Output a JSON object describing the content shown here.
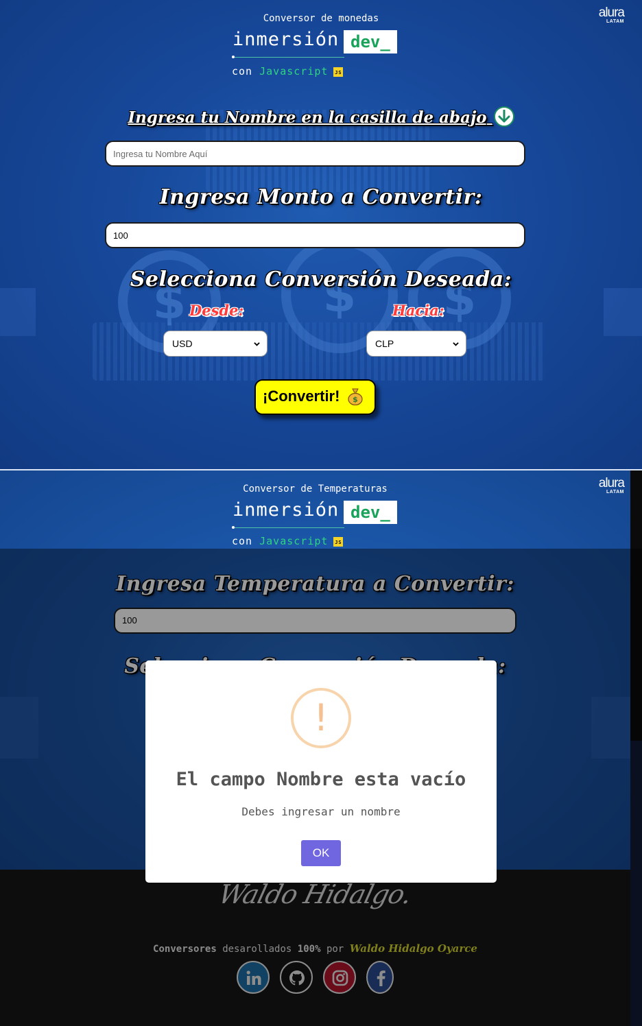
{
  "currency": {
    "header_title": "Conversor de monedas",
    "logo_word": "inmersión",
    "logo_dev": "dev_",
    "logo_con": "con",
    "logo_lang": "Javascript",
    "js_badge": "JS",
    "brand_main": "alura",
    "brand_sub": "LATAM",
    "name_heading": "Ingresa tu Nombre en la casilla de abajo",
    "name_placeholder": "Ingresa tu Nombre Aquí",
    "amount_heading": "Ingresa Monto a Convertir:",
    "amount_value": "100",
    "select_heading": "Selecciona Conversión Deseada:",
    "from_label": "Desde:",
    "to_label": "Hacia:",
    "from_value": "USD",
    "to_value": "CLP",
    "convert_button": "¡Convertir!"
  },
  "temperature": {
    "header_title": "Conversor de Temperaturas",
    "logo_word": "inmersión",
    "logo_dev": "dev_",
    "logo_con": "con",
    "logo_lang": "Javascript",
    "js_badge": "JS",
    "brand_main": "alura",
    "brand_sub": "LATAM",
    "amount_heading": "Ingresa Temperatura a Convertir:",
    "amount_value": "100",
    "select_heading": "Selecciona Conversión Deseada:"
  },
  "footer": {
    "signature": "Waldo Hidalgo.",
    "credits_lead": "Conversores",
    "credits_mid": "desarollados",
    "credits_pct": "100%",
    "credits_by": "por",
    "author": "Waldo Hidalgo Oyarce",
    "social": [
      "linkedin-icon",
      "github-icon",
      "instagram-icon",
      "facebook-icon"
    ]
  },
  "modal": {
    "icon": "!",
    "title": "El campo Nombre esta vacío",
    "text": "Debes ingresar un nombre",
    "ok_label": "OK"
  },
  "colors": {
    "accent_green": "#19a35a",
    "convert_yellow": "#ffff00",
    "label_red": "#ff3b3b",
    "ok_purple": "#7066e0",
    "warning_orange": "#f8d4ac"
  }
}
